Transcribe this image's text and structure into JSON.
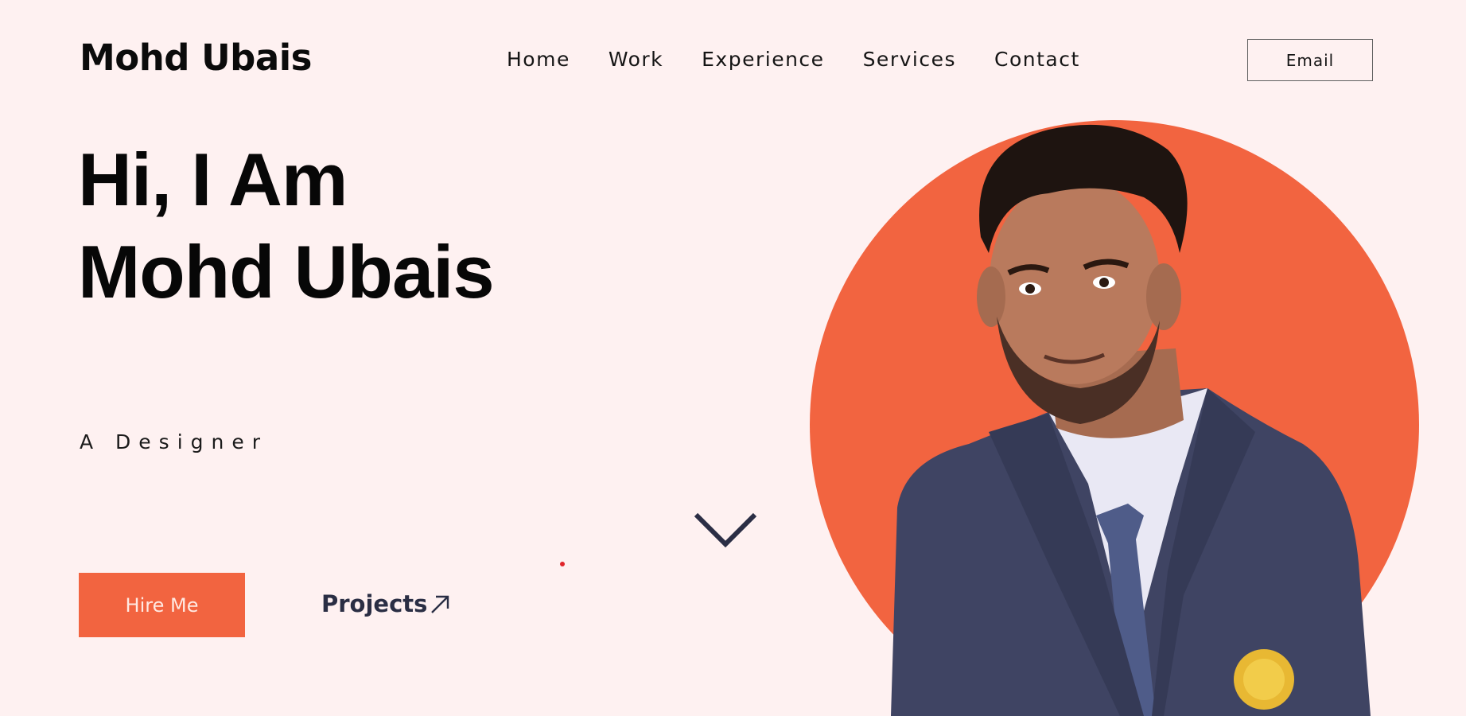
{
  "header": {
    "logo": "Mohd Ubais",
    "nav": [
      "Home",
      "Work",
      "Experience",
      "Services",
      "Contact"
    ],
    "email_label": "Email"
  },
  "hero": {
    "greeting_line1": "Hi, I Am",
    "greeting_line2": "Mohd Ubais",
    "role": "A Designer",
    "hire_label": "Hire Me",
    "projects_label": "Projects"
  },
  "colors": {
    "background": "#fef1f1",
    "accent": "#f26440",
    "dark": "#2a2e44"
  },
  "icons": {
    "scroll": "chevron-down-icon",
    "projects": "arrow-up-right-icon"
  }
}
